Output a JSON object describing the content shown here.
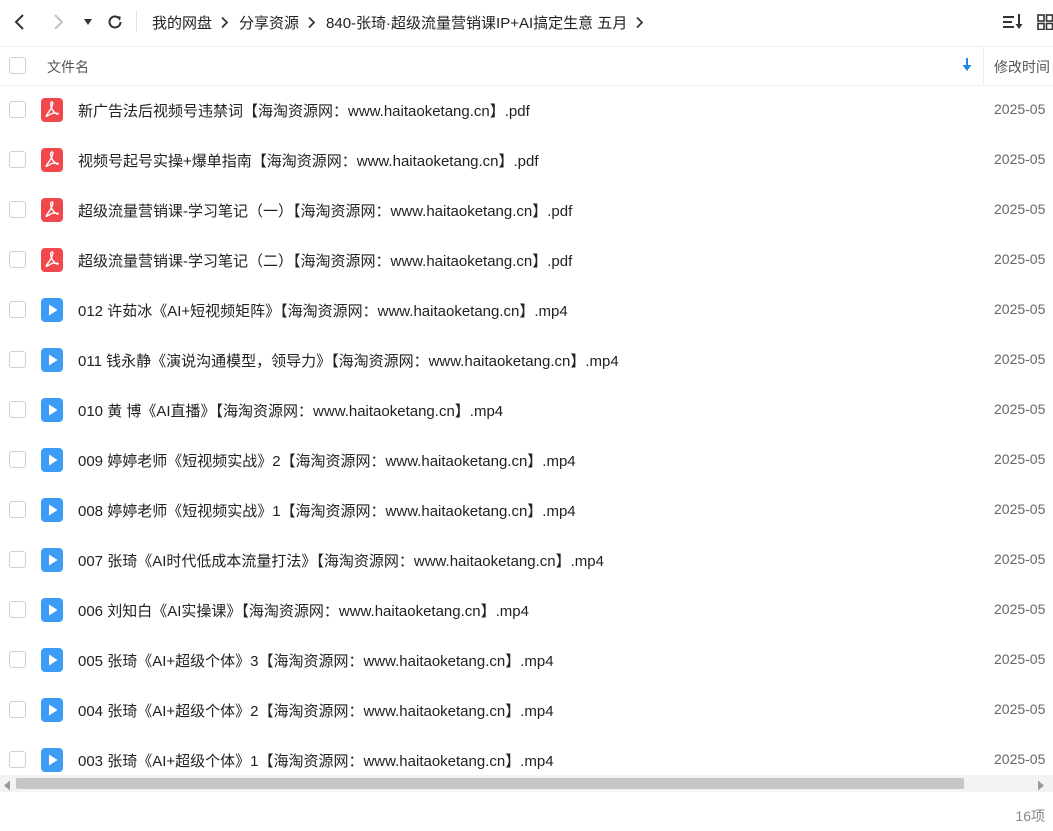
{
  "breadcrumb": {
    "items": [
      "我的网盘",
      "分享资源",
      "840-张琦·超级流量营销课IP+AI搞定生意 五月"
    ]
  },
  "header": {
    "name_col": "文件名",
    "modified_col": "修改时间"
  },
  "files": [
    {
      "name": "新广告法后视频号违禁词【海淘资源网：www.haitaoketang.cn】.pdf",
      "type": "pdf",
      "date": "2025-05"
    },
    {
      "name": "视频号起号实操+爆单指南【海淘资源网：www.haitaoketang.cn】.pdf",
      "type": "pdf",
      "date": "2025-05"
    },
    {
      "name": "超级流量营销课-学习笔记（一）【海淘资源网：www.haitaoketang.cn】.pdf",
      "type": "pdf",
      "date": "2025-05"
    },
    {
      "name": "超级流量营销课-学习笔记（二）【海淘资源网：www.haitaoketang.cn】.pdf",
      "type": "pdf",
      "date": "2025-05"
    },
    {
      "name": "012 许茹冰《AI+短视频矩阵》【海淘资源网：www.haitaoketang.cn】.mp4",
      "type": "video",
      "date": "2025-05"
    },
    {
      "name": "011 钱永静《演说沟通模型，领导力》【海淘资源网：www.haitaoketang.cn】.mp4",
      "type": "video",
      "date": "2025-05"
    },
    {
      "name": "010 黄 博《AI直播》【海淘资源网：www.haitaoketang.cn】.mp4",
      "type": "video",
      "date": "2025-05"
    },
    {
      "name": "009 婷婷老师《短视频实战》2【海淘资源网：www.haitaoketang.cn】.mp4",
      "type": "video",
      "date": "2025-05"
    },
    {
      "name": "008 婷婷老师《短视频实战》1【海淘资源网：www.haitaoketang.cn】.mp4",
      "type": "video",
      "date": "2025-05"
    },
    {
      "name": "007 张琦《AI时代低成本流量打法》【海淘资源网：www.haitaoketang.cn】.mp4",
      "type": "video",
      "date": "2025-05"
    },
    {
      "name": "006 刘知白《AI实操课》【海淘资源网：www.haitaoketang.cn】.mp4",
      "type": "video",
      "date": "2025-05"
    },
    {
      "name": "005 张琦《AI+超级个体》3【海淘资源网：www.haitaoketang.cn】.mp4",
      "type": "video",
      "date": "2025-05"
    },
    {
      "name": "004 张琦《AI+超级个体》2【海淘资源网：www.haitaoketang.cn】.mp4",
      "type": "video",
      "date": "2025-05"
    },
    {
      "name": "003 张琦《AI+超级个体》1【海淘资源网：www.haitaoketang.cn】.mp4",
      "type": "video",
      "date": "2025-05"
    }
  ],
  "footer": {
    "count": "16项"
  },
  "icons": {
    "back": "back-arrow-icon",
    "forward": "forward-arrow-icon",
    "history": "dropdown-caret-icon",
    "refresh": "refresh-icon",
    "sort": "sort-list-icon",
    "view": "grid-view-icon",
    "pdf": "pdf-file-icon",
    "video": "video-file-icon"
  },
  "colors": {
    "pdf": "#f0484d",
    "video": "#3d9cf5",
    "accent": "#1e88e5"
  }
}
